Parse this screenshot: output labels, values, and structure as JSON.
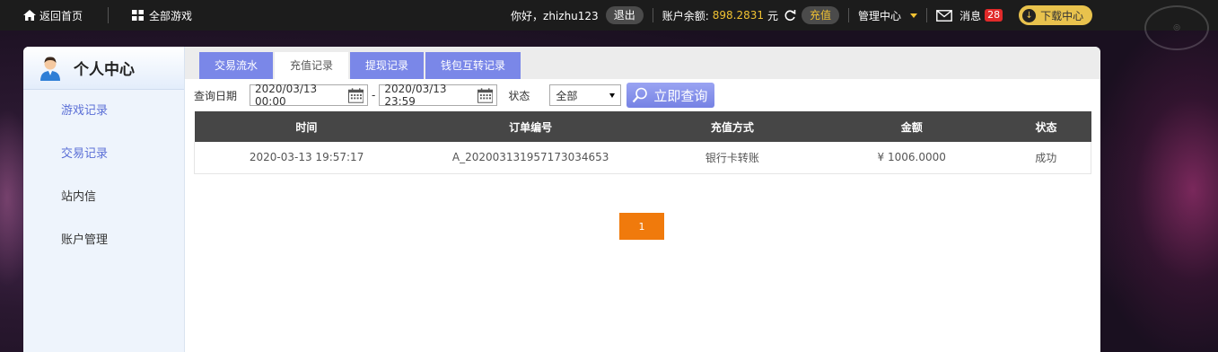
{
  "topbar": {
    "home_label": "返回首页",
    "all_games_label": "全部游戏",
    "greeting": "你好，zhizhu123",
    "logout_label": "退出",
    "balance_label": "账户余额:",
    "balance_value": "898.2831",
    "currency": "元",
    "recharge_label": "充值",
    "management_label": "管理中心",
    "messages_label": "消息",
    "messages_count": "28",
    "download_label": "下载中心",
    "accent_color": "#f1c232"
  },
  "sidebar": {
    "title": "个人中心",
    "items": [
      {
        "label": "游戏记录"
      },
      {
        "label": "交易记录"
      },
      {
        "label": "站内信"
      },
      {
        "label": "账户管理"
      }
    ]
  },
  "tabs": [
    {
      "label": "交易流水"
    },
    {
      "label": "充值记录"
    },
    {
      "label": "提现记录"
    },
    {
      "label": "钱包互转记录"
    }
  ],
  "query": {
    "date_label": "查询日期",
    "start_date": "2020/03/13 00:00",
    "end_date": "2020/03/13 23:59",
    "dash": "-",
    "status_label": "状态",
    "status_value": "全部",
    "search_label": "立即查询"
  },
  "table": {
    "headers": [
      "时间",
      "订单编号",
      "充值方式",
      "金额",
      "状态"
    ],
    "rows": [
      [
        "2020-03-13 19:57:17",
        "A_202003131957173034653",
        "银行卡转账",
        "¥ 1006.0000",
        "成功"
      ]
    ]
  },
  "pagination": {
    "current_page": "1"
  }
}
